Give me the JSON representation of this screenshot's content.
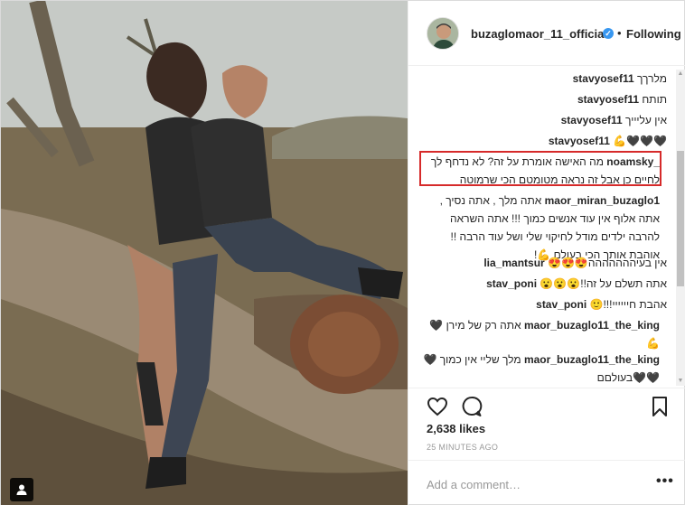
{
  "header": {
    "username": "buzaglomaor_11_official",
    "verified_icon": "verified-badge-icon",
    "separator": "•",
    "follow_label": "Following"
  },
  "comments": [
    {
      "user": "stavyosef11",
      "text": "מלרךך"
    },
    {
      "user": "stavyosef11",
      "text": "תותח"
    },
    {
      "user": "stavyosef11",
      "text": "אין עליייך"
    },
    {
      "user": "stavyosef11",
      "text": "🖤🖤🖤💪"
    },
    {
      "user": "noamsky_",
      "text": "מה האישה אומרת על זה? לא נדחף לך לחיים כן אבל זה נראה מטומטם הכי שרמוטה"
    },
    {
      "user": "maor_miran_buzaglo1",
      "text": "אתה מלך , אתה נסיך , אתה אלוף אין עוד אנשים כמוך !!! אתה השראה להרבה ילדים מודל לחיקוי שלי ושל עוד הרבה !! אוהבת אותך הכי בעולם 💪!"
    },
    {
      "user": "lia_mantsur",
      "text": "אין בעיההההההה😍😍😍"
    },
    {
      "user": "stav_poni",
      "text": "אתה תשלם על זה!!😮😮😮"
    },
    {
      "user": "stav_poni",
      "text": "אהבת חיייייי!!!🙂"
    },
    {
      "user": "maor_buzaglo11_the_king",
      "text": "אתה רק של מירן 🖤💪"
    },
    {
      "user": "maor_buzaglo11_the_king",
      "text": "מלך שליי אין כמוך 🖤🖤🖤בעולםם"
    }
  ],
  "actions": {
    "like_icon": "heart-icon",
    "comment_icon": "comment-bubble-icon",
    "save_icon": "bookmark-icon"
  },
  "likes": "2,638 likes",
  "time": "25 MINUTES AGO",
  "add_comment_placeholder": "Add a comment…",
  "more_label": "•••",
  "colors": {
    "highlight_border": "#d62a2a",
    "verified": "#3897f0",
    "text": "#262626",
    "muted": "#999999"
  }
}
